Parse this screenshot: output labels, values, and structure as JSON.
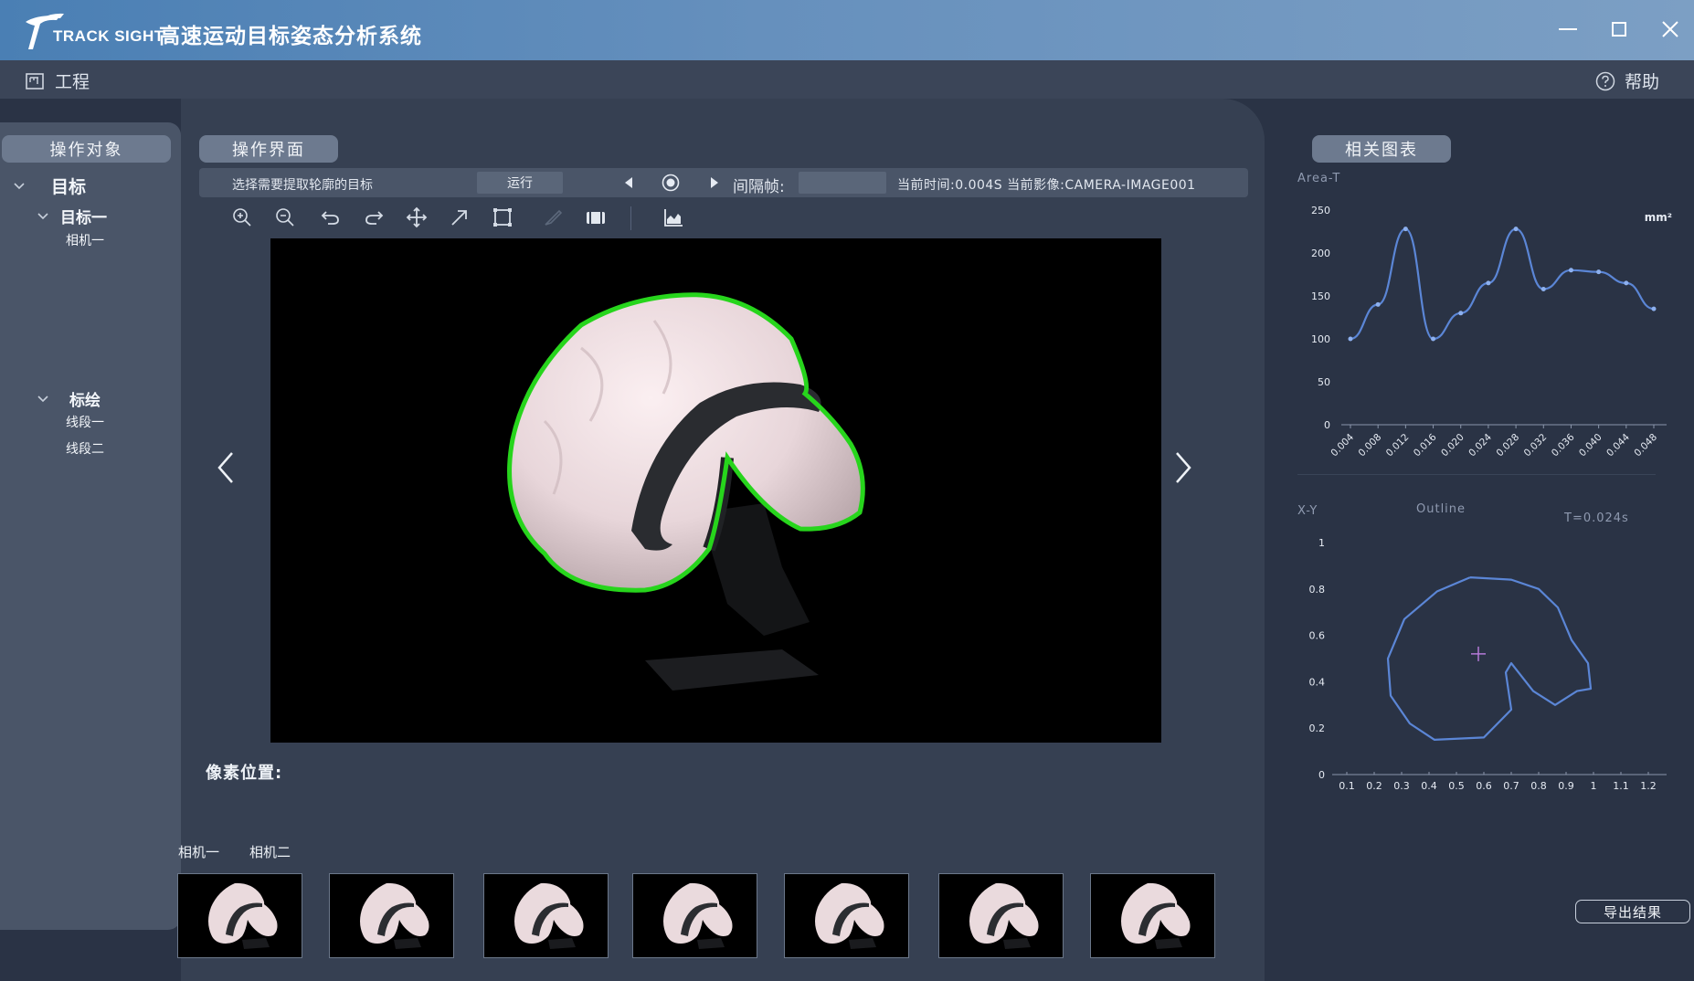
{
  "app": {
    "logo_text": "TRACK SIGHT",
    "title": "高速运动目标姿态分析系统"
  },
  "menubar": {
    "project": "工程",
    "help": "帮助"
  },
  "left_panel": {
    "title": "操作对象",
    "tree": [
      {
        "label": "目标",
        "level": 0,
        "expanded": true
      },
      {
        "label": "目标一",
        "level": 1,
        "expanded": true
      },
      {
        "label": "相机一",
        "level": 2
      },
      {
        "label": "标绘",
        "level": 1,
        "expanded": true
      },
      {
        "label": "线段一",
        "level": 2
      },
      {
        "label": "线段二",
        "level": 2
      }
    ]
  },
  "center": {
    "title": "操作界面",
    "instruction": "选择需要提取轮廓的目标",
    "run_label": "运行",
    "interval_label": "间隔帧:",
    "interval_value": "",
    "status": "当前时间:0.004S 当前影像:CAMERA-IMAGE001",
    "toolbar": [
      "zoom-in",
      "zoom-out",
      "undo",
      "redo",
      "move",
      "arrow",
      "crop",
      "brush",
      "film",
      "chart"
    ],
    "pixel_position_label": "像素位置:",
    "camera_tabs": [
      "相机一",
      "相机二"
    ],
    "thumbnail_count": 7
  },
  "right_panel": {
    "title": "相关图表",
    "export_label": "导出结果"
  },
  "chart_data": [
    {
      "type": "line",
      "title": "Area-T",
      "unit": "mm²",
      "ylim": [
        0,
        250
      ],
      "yticks": [
        0,
        50,
        100,
        150,
        200,
        250
      ],
      "x": [
        "0.004",
        "0.008",
        "0.012",
        "0.016",
        "0.020",
        "0.024",
        "0.028",
        "0.032",
        "0.036",
        "0.040",
        "0.044",
        "0.048"
      ],
      "values": [
        100,
        140,
        228,
        100,
        130,
        165,
        228,
        158,
        180,
        178,
        165,
        135
      ],
      "color": "#5b86d6",
      "grid": false
    },
    {
      "type": "line",
      "title": "X-Y",
      "subtitle": "Outline",
      "annotation": "T=0.024s",
      "xlim": [
        0,
        1.2
      ],
      "ylim": [
        0,
        1
      ],
      "xticks": [
        "0.1",
        "0.2",
        "0.3",
        "0.4",
        "0.5",
        "0.6",
        "0.7",
        "0.8",
        "0.9",
        "1",
        "1.1",
        "1.2"
      ],
      "yticks": [
        "0",
        "0.2",
        "0.4",
        "0.6",
        "0.8",
        "1"
      ],
      "points": [
        [
          0.55,
          0.85
        ],
        [
          0.7,
          0.84
        ],
        [
          0.8,
          0.8
        ],
        [
          0.87,
          0.72
        ],
        [
          0.92,
          0.58
        ],
        [
          0.98,
          0.48
        ],
        [
          0.99,
          0.37
        ],
        [
          0.94,
          0.36
        ],
        [
          0.86,
          0.3
        ],
        [
          0.78,
          0.36
        ],
        [
          0.7,
          0.48
        ],
        [
          0.68,
          0.44
        ],
        [
          0.7,
          0.28
        ],
        [
          0.6,
          0.16
        ],
        [
          0.42,
          0.15
        ],
        [
          0.33,
          0.22
        ],
        [
          0.26,
          0.34
        ],
        [
          0.25,
          0.5
        ],
        [
          0.31,
          0.67
        ],
        [
          0.43,
          0.79
        ],
        [
          0.55,
          0.85
        ]
      ],
      "center": [
        0.58,
        0.52
      ],
      "color": "#5b86d6",
      "grid": false
    }
  ]
}
